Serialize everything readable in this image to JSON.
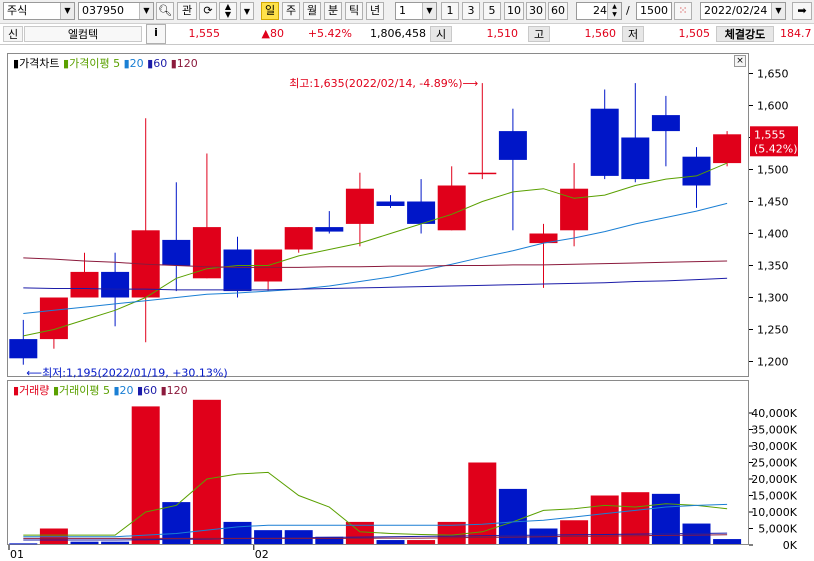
{
  "toolbar": {
    "market": "주식",
    "code": "037950",
    "btn_gwan": "관",
    "period_buttons": [
      "일",
      "주",
      "월",
      "분",
      "틱",
      "년"
    ],
    "active_period": "일",
    "interval_value": "1",
    "interval_buttons": [
      "1",
      "3",
      "5",
      "10",
      "30",
      "60"
    ],
    "count_value": "24",
    "separator": "/",
    "total_count": "1500",
    "date_value": "2022/02/24"
  },
  "info": {
    "badge": "신",
    "name": "엘컴텍",
    "info_button": "i",
    "price": "1,555",
    "change": "▲80",
    "change_pct": "+5.42%",
    "volume": "1,806,458",
    "open_label": "시",
    "open": "1,510",
    "high_label": "고",
    "high": "1,560",
    "low_label": "저",
    "low": "1,505",
    "strength_label": "체결강도",
    "strength": "184.7"
  },
  "colors": {
    "up": "#e0001a",
    "down": "#0016c8",
    "ma5": "#5aa000",
    "ma20": "#1a7fd4",
    "ma60": "#1c1ca8",
    "ma120": "#8b1a3c"
  },
  "price_legend": {
    "title": "가격차트",
    "ma_label": "가격이평",
    "ma_periods": [
      "5",
      "20",
      "60",
      "120"
    ]
  },
  "volume_legend": {
    "title": "거래량",
    "ma_label": "거래이평",
    "ma_periods": [
      "5",
      "20",
      "60",
      "120"
    ]
  },
  "annotations": {
    "high_note": "최고:1,635(2022/02/14, -4.89%)⟶",
    "low_note": "⟵최저:1,195(2022/01/19, +30.13%)",
    "last_price_tag": "1,555",
    "last_pct_tag": "(5.42%)"
  },
  "x_labels": [
    "01",
    "02"
  ],
  "chart_data": [
    {
      "type": "candlestick",
      "title": "가격차트",
      "ylim": [
        1170,
        1670
      ],
      "y_ticks": [
        "1,650",
        "1,600",
        "1,550",
        "1,500",
        "1,450",
        "1,400",
        "1,350",
        "1,300",
        "1,250",
        "1,200"
      ],
      "candles": [
        {
          "o": 1235,
          "h": 1265,
          "l": 1195,
          "c": 1205
        },
        {
          "o": 1235,
          "h": 1300,
          "l": 1220,
          "c": 1300
        },
        {
          "o": 1300,
          "h": 1370,
          "l": 1300,
          "c": 1340
        },
        {
          "o": 1340,
          "h": 1370,
          "l": 1255,
          "c": 1300
        },
        {
          "o": 1300,
          "h": 1580,
          "l": 1230,
          "c": 1405
        },
        {
          "o": 1390,
          "h": 1480,
          "l": 1310,
          "c": 1350
        },
        {
          "o": 1330,
          "h": 1525,
          "l": 1330,
          "c": 1410
        },
        {
          "o": 1375,
          "h": 1395,
          "l": 1300,
          "c": 1310
        },
        {
          "o": 1325,
          "h": 1375,
          "l": 1310,
          "c": 1375
        },
        {
          "o": 1375,
          "h": 1410,
          "l": 1370,
          "c": 1410
        },
        {
          "o": 1410,
          "h": 1435,
          "l": 1400,
          "c": 1403
        },
        {
          "o": 1415,
          "h": 1495,
          "l": 1380,
          "c": 1470
        },
        {
          "o": 1450,
          "h": 1460,
          "l": 1440,
          "c": 1443
        },
        {
          "o": 1450,
          "h": 1485,
          "l": 1400,
          "c": 1415
        },
        {
          "o": 1405,
          "h": 1505,
          "l": 1405,
          "c": 1475
        },
        {
          "o": 1495,
          "h": 1635,
          "l": 1485,
          "c": 1495
        },
        {
          "o": 1560,
          "h": 1595,
          "l": 1405,
          "c": 1515
        },
        {
          "o": 1385,
          "h": 1415,
          "l": 1315,
          "c": 1400
        },
        {
          "o": 1405,
          "h": 1510,
          "l": 1380,
          "c": 1470
        },
        {
          "o": 1595,
          "h": 1625,
          "l": 1485,
          "c": 1490
        },
        {
          "o": 1550,
          "h": 1635,
          "l": 1480,
          "c": 1485
        },
        {
          "o": 1585,
          "h": 1615,
          "l": 1505,
          "c": 1560
        },
        {
          "o": 1520,
          "h": 1535,
          "l": 1440,
          "c": 1475
        },
        {
          "o": 1510,
          "h": 1560,
          "l": 1505,
          "c": 1555
        }
      ],
      "ma": {
        "5": [
          1240,
          1250,
          1265,
          1280,
          1300,
          1330,
          1345,
          1350,
          1350,
          1365,
          1375,
          1385,
          1400,
          1415,
          1430,
          1450,
          1465,
          1470,
          1455,
          1460,
          1475,
          1485,
          1490,
          1510
        ],
        "20": [
          1275,
          1280,
          1285,
          1290,
          1295,
          1300,
          1305,
          1307,
          1310,
          1313,
          1318,
          1325,
          1332,
          1342,
          1352,
          1363,
          1373,
          1385,
          1393,
          1403,
          1415,
          1425,
          1435,
          1447
        ],
        "60": [
          1315,
          1314,
          1314,
          1313,
          1313,
          1312,
          1312,
          1312,
          1312,
          1313,
          1314,
          1315,
          1316,
          1317,
          1318,
          1319,
          1320,
          1321,
          1322,
          1323,
          1325,
          1326,
          1328,
          1330
        ],
        "120": [
          1362,
          1360,
          1357,
          1355,
          1352,
          1350,
          1348,
          1347,
          1347,
          1347,
          1348,
          1348,
          1349,
          1349,
          1350,
          1350,
          1351,
          1351,
          1352,
          1353,
          1354,
          1355,
          1356,
          1357
        ]
      }
    },
    {
      "type": "bar",
      "title": "거래량",
      "ylim": [
        0,
        42000
      ],
      "y_ticks": [
        "40,000K",
        "35,000K",
        "30,000K",
        "25,000K",
        "20,000K",
        "15,000K",
        "10,000K",
        "5,000K",
        "0K"
      ],
      "values": [
        500,
        5000,
        1000,
        1000,
        42000,
        13000,
        44000,
        7000,
        4500,
        4500,
        2500,
        7000,
        1500,
        1500,
        7000,
        25000,
        17000,
        5000,
        7500,
        15000,
        16000,
        15500,
        6500,
        1800
      ],
      "up": [
        false,
        true,
        false,
        false,
        true,
        false,
        true,
        false,
        false,
        false,
        false,
        true,
        false,
        true,
        true,
        true,
        false,
        false,
        true,
        true,
        true,
        false,
        false,
        false
      ],
      "ma": {
        "5": [
          3000,
          3000,
          3000,
          3000,
          10000,
          12000,
          20000,
          21500,
          22000,
          15000,
          11500,
          4000,
          3500,
          3200,
          3000,
          4000,
          7000,
          10500,
          11000,
          12000,
          11500,
          12500,
          12000,
          11000
        ],
        "20": [
          2500,
          2500,
          2500,
          2500,
          3000,
          3500,
          4500,
          5500,
          6000,
          6000,
          6000,
          6000,
          6000,
          6000,
          6000,
          6300,
          7000,
          7500,
          8500,
          9500,
          10500,
          11500,
          12000,
          12300
        ],
        "60": [
          1500,
          1500,
          1500,
          1500,
          1600,
          1700,
          1800,
          2000,
          2100,
          2200,
          2300,
          2400,
          2500,
          2600,
          2700,
          2800,
          2900,
          3000,
          3100,
          3200,
          3300,
          3400,
          3500,
          3600
        ],
        "120": [
          2000,
          2000,
          2000,
          2000,
          2000,
          2000,
          2000,
          2000,
          2000,
          2000,
          2000,
          2000,
          2100,
          2100,
          2200,
          2300,
          2400,
          2500,
          2600,
          2700,
          2800,
          2900,
          3000,
          3100
        ]
      }
    }
  ]
}
